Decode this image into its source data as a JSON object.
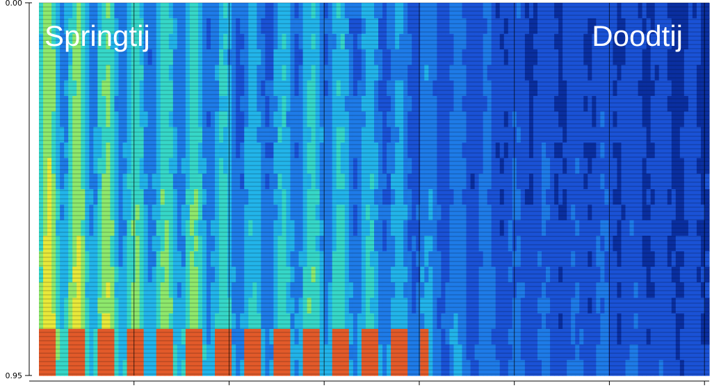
{
  "chart_data": {
    "type": "heatmap",
    "title": "",
    "xlabel": "",
    "ylabel": "",
    "yticks": [
      "0.00",
      "0.95"
    ],
    "annotations": [
      "Springtij",
      "Doodtij"
    ],
    "colormap": [
      "#0a2fa0",
      "#1a52d6",
      "#1e7be8",
      "#22b4ea",
      "#36d7c8",
      "#8ee86c",
      "#e8e83a",
      "#e25a2a"
    ],
    "grid": true,
    "x_major_ticks": 7,
    "column_intensity": [
      0.62,
      0.58,
      0.55,
      0.48,
      0.52,
      0.45,
      0.38,
      0.42,
      0.47,
      0.4,
      0.36,
      0.3,
      0.27,
      0.22,
      0.2,
      0.18,
      0.2,
      0.17,
      0.15,
      0.14
    ]
  }
}
